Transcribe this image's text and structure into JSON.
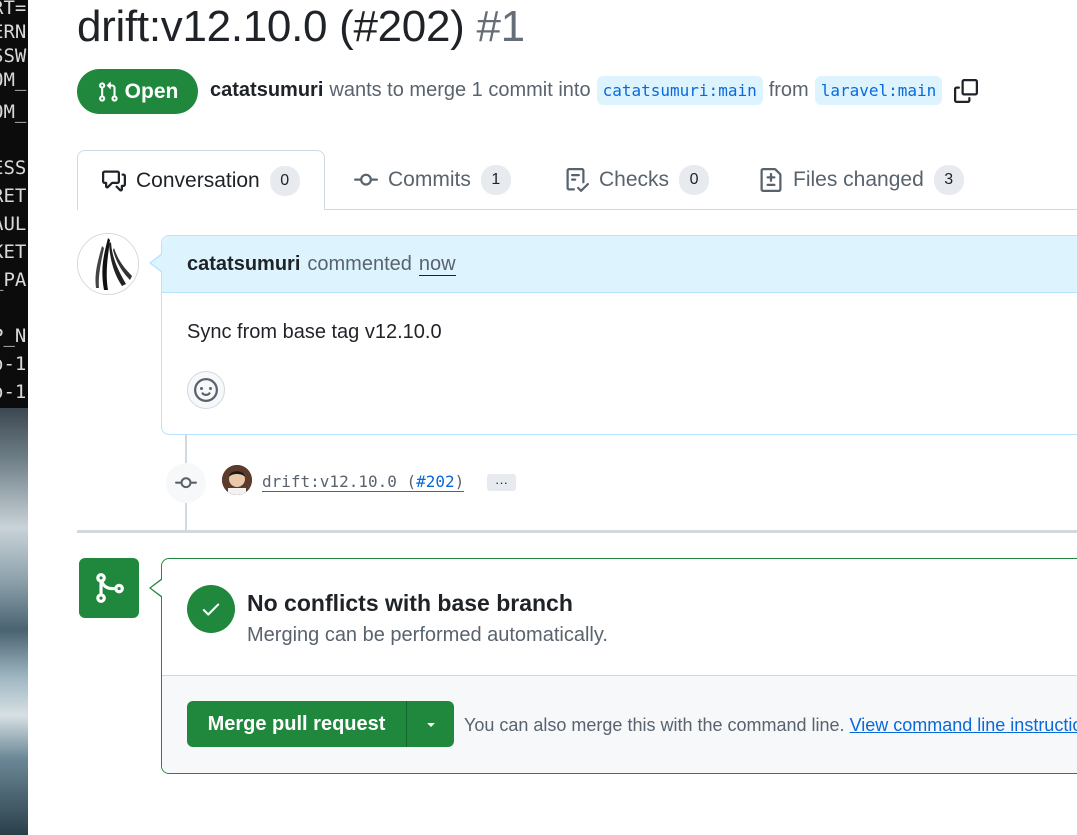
{
  "background": {
    "terminal_lines": [
      "RT=",
      "ERN",
      "SSW",
      "OM_",
      "OM_",
      "",
      "ESS",
      "RET",
      "AUL",
      "KET",
      "_PA",
      "",
      "P_N",
      "o-1",
      "o-1"
    ]
  },
  "pr": {
    "title": "drift:v12.10.0 (#202)",
    "number": "#1",
    "state": "Open",
    "author": "catatsumuri",
    "meta_text": "wants to merge 1 commit into",
    "base_branch": "catatsumuri:main",
    "from_text": "from",
    "head_branch": "laravel:main"
  },
  "tabs": [
    {
      "label": "Conversation",
      "count": "0"
    },
    {
      "label": "Commits",
      "count": "1"
    },
    {
      "label": "Checks",
      "count": "0"
    },
    {
      "label": "Files changed",
      "count": "3"
    }
  ],
  "comment": {
    "author": "catatsumuri",
    "action": "commented",
    "time": "now",
    "body": "Sync from base tag v12.10.0"
  },
  "commit": {
    "message": "drift:v12.10.0 (",
    "ref": "#202",
    "close": ")",
    "more": "···"
  },
  "merge": {
    "title": "No conflicts with base branch",
    "subtitle": "Merging can be performed automatically.",
    "button": "Merge pull request",
    "hint": "You can also merge this with the command line.",
    "hint_link": "View command line instructions."
  },
  "colors": {
    "green": "#1f883d",
    "blue_link": "#0969da",
    "header_blue": "#ddf4ff"
  }
}
